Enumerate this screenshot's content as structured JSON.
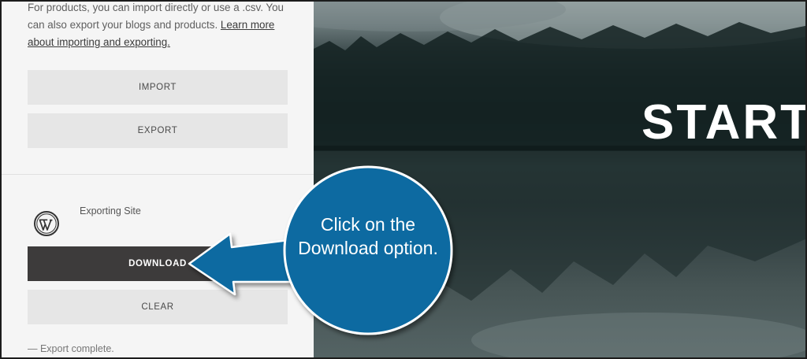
{
  "panel": {
    "intro_prefix": "For products, you can import directly or use a .csv. You can also export your blogs and products. ",
    "intro_link": "Learn more about importing and exporting.",
    "import_label": "IMPORT",
    "export_label": "EXPORT",
    "export_item_title": "Exporting Site",
    "export_item_icon": "wordpress-logo-icon",
    "download_label": "DOWNLOAD",
    "clear_label": "CLEAR",
    "status_text": "— Export complete."
  },
  "hero": {
    "title": "START"
  },
  "callout": {
    "text": "Click on the Download option.",
    "color": "#0a6aa1"
  },
  "colors": {
    "panel_bg": "#f5f5f5",
    "button_bg": "#e6e6e6",
    "download_bg": "#3d3b3b",
    "callout_blue": "#0a6aa1"
  }
}
